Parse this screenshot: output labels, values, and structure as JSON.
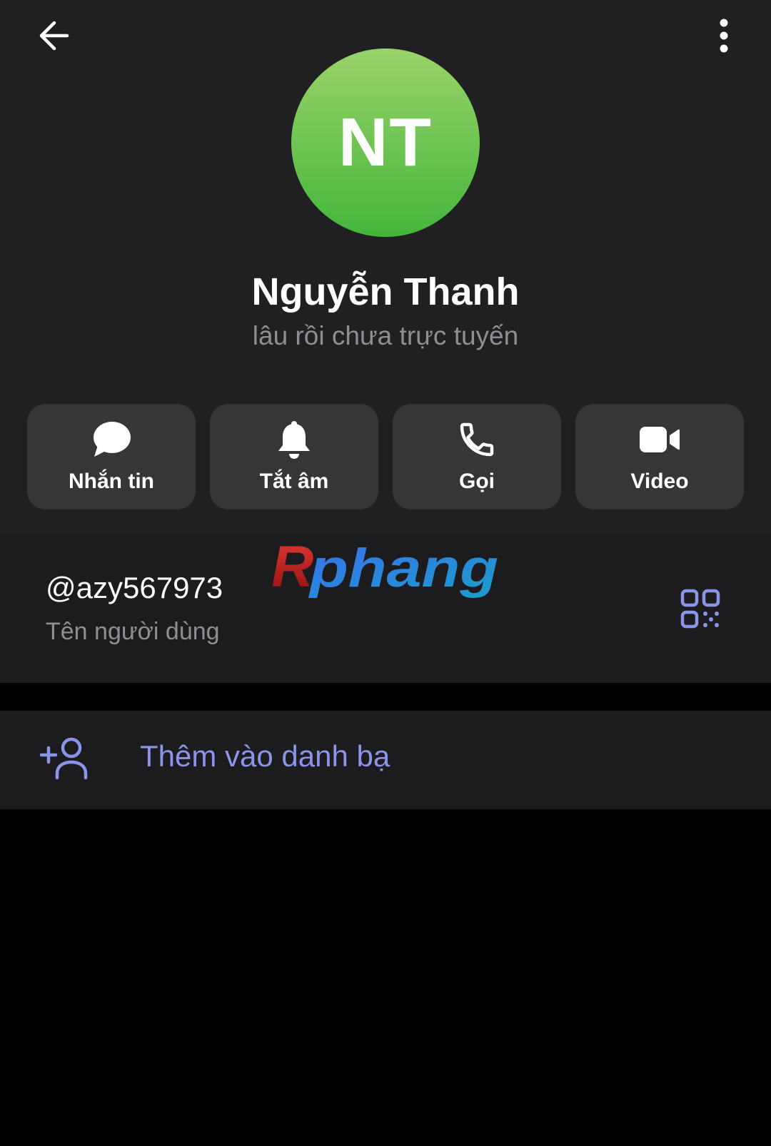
{
  "header": {
    "back_icon": "arrow-left-icon",
    "more_icon": "more-vertical-icon"
  },
  "profile": {
    "initials": "NT",
    "name": "Nguyễn Thanh",
    "status": "lâu rồi chưa trực tuyến",
    "avatar_gradient_top": "#9ad36a",
    "avatar_gradient_bottom": "#44b63c"
  },
  "actions": [
    {
      "label": "Nhắn tin",
      "icon": "chat-bubble-icon"
    },
    {
      "label": "Tắt âm",
      "icon": "bell-icon"
    },
    {
      "label": "Gọi",
      "icon": "phone-icon"
    },
    {
      "label": "Video",
      "icon": "video-camera-icon"
    }
  ],
  "username": {
    "value": "@azy567973",
    "caption": "Tên người dùng",
    "qr_icon": "qr-code-icon"
  },
  "watermark": {
    "text": "Rphang"
  },
  "add_contact": {
    "label": "Thêm vào danh bạ",
    "icon": "add-user-icon"
  },
  "colors": {
    "accent": "#8a94e8",
    "panel": "#202022",
    "card": "#1c1c1e",
    "button": "#363639",
    "secondary_text": "#8e8e93"
  }
}
